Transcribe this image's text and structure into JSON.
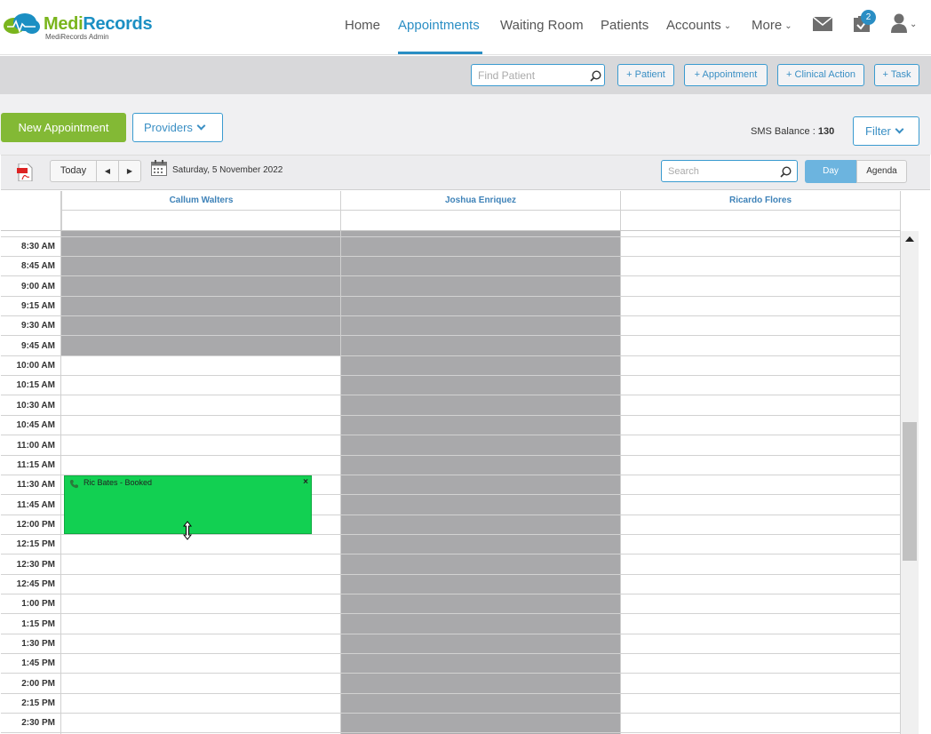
{
  "brand": {
    "name_part1": "Medi",
    "name_part2": "Records",
    "subtitle": "MediRecords Admin"
  },
  "nav": {
    "home": "Home",
    "appointments": "Appointments",
    "waiting_room": "Waiting Room",
    "patients": "Patients",
    "accounts": "Accounts",
    "more": "More",
    "tasks_badge": "2"
  },
  "actions": {
    "find_patient_placeholder": "Find Patient",
    "add_patient": "+ Patient",
    "add_appointment": "+ Appointment",
    "add_clinical_action": "+ Clinical Action",
    "add_task": "+ Task"
  },
  "toolbar": {
    "new_appointment": "New Appointment",
    "providers": "Providers",
    "sms_label": "SMS Balance :",
    "sms_value": "130",
    "filter": "Filter"
  },
  "calendar": {
    "today": "Today",
    "prev": "◀",
    "next": "▶",
    "date": "Saturday, 5 November 2022",
    "search_placeholder": "Search",
    "view_day": "Day",
    "view_agenda": "Agenda",
    "providers": [
      "Callum Walters",
      "Joshua Enriquez",
      "Ricardo Flores"
    ],
    "times": [
      "8:30 AM",
      "8:45 AM",
      "9:00 AM",
      "9:15 AM",
      "9:30 AM",
      "9:45 AM",
      "10:00 AM",
      "10:15 AM",
      "10:30 AM",
      "10:45 AM",
      "11:00 AM",
      "11:15 AM",
      "11:30 AM",
      "11:45 AM",
      "12:00 PM",
      "12:15 PM",
      "12:30 PM",
      "12:45 PM",
      "1:00 PM",
      "1:15 PM",
      "1:30 PM",
      "1:45 PM",
      "2:00 PM",
      "2:15 PM",
      "2:30 PM"
    ],
    "appointment": {
      "title": "Ric Bates - Booked",
      "color": "#12d052"
    }
  },
  "colors": {
    "accent": "#2a8ec4",
    "green_button": "#83b935",
    "unavailable": "#a9a9ab"
  }
}
